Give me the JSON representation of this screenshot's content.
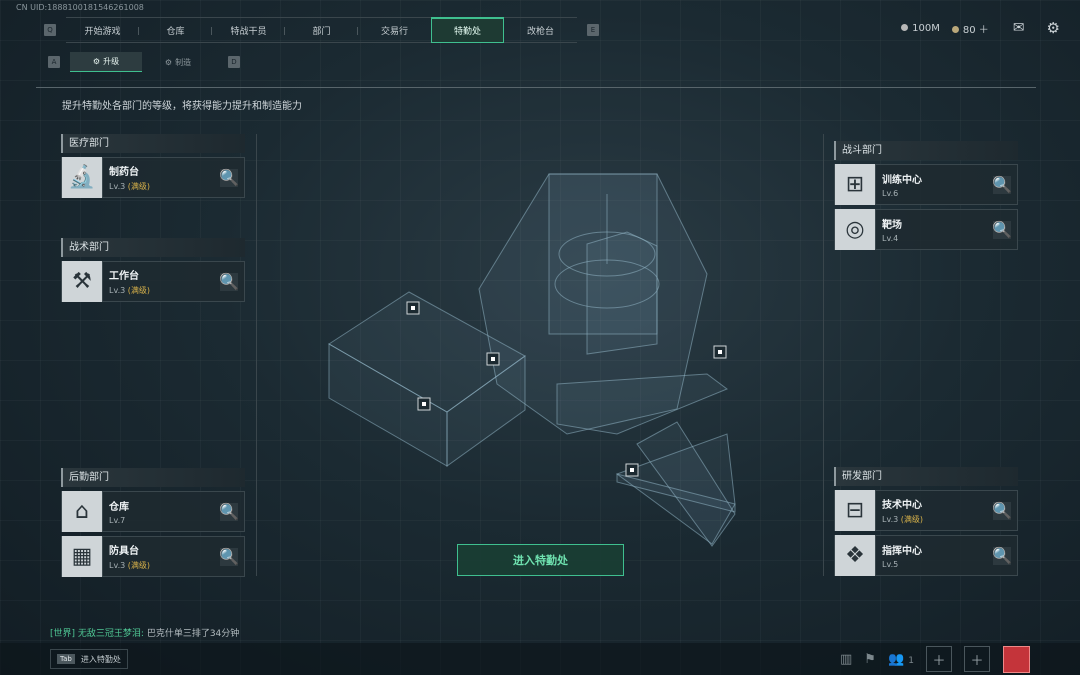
{
  "uid": "CN UID:1888100181546261008",
  "nav": {
    "left_key": "Q",
    "right_key": "E",
    "tabs": [
      {
        "label": "开始游戏"
      },
      {
        "label": "仓库"
      },
      {
        "label": "特战干员"
      },
      {
        "label": "部门"
      },
      {
        "label": "交易行"
      },
      {
        "label": "特勤处"
      },
      {
        "label": "改枪台"
      }
    ],
    "active_tab": "特勤处"
  },
  "resources": {
    "money": "100M",
    "coupons": "80"
  },
  "subnav": {
    "left_key": "A",
    "right_key": "D",
    "tabs": [
      "升级",
      "制造"
    ]
  },
  "intro": "提升特勤处各部门的等级，将获得能力提升和制造能力",
  "departments": {
    "medical": {
      "title": "医疗部门",
      "items": [
        {
          "name": "制药台",
          "level": "Lv.3",
          "tag": "(满级)"
        }
      ]
    },
    "tactical": {
      "title": "战术部门",
      "items": [
        {
          "name": "工作台",
          "level": "Lv.3",
          "tag": "(满级)"
        }
      ]
    },
    "logistics": {
      "title": "后勤部门",
      "items": [
        {
          "name": "仓库",
          "level": "Lv.7",
          "tag": ""
        },
        {
          "name": "防具台",
          "level": "Lv.3",
          "tag": "(满级)"
        }
      ]
    },
    "combat": {
      "title": "战斗部门",
      "items": [
        {
          "name": "训练中心",
          "level": "Lv.6",
          "tag": ""
        },
        {
          "name": "靶场",
          "level": "Lv.4",
          "tag": ""
        }
      ]
    },
    "research": {
      "title": "研发部门",
      "items": [
        {
          "name": "技术中心",
          "level": "Lv.3",
          "tag": "(满级)"
        },
        {
          "name": "指挥中心",
          "level": "Lv.5",
          "tag": ""
        }
      ]
    }
  },
  "enter_button": "进入特勤处",
  "chat": {
    "channel": "[世界]",
    "user": "无敌三冠王梦泪:",
    "message": "巴克什单三排了34分钟"
  },
  "tab_hint": {
    "key": "Tab",
    "label": "进入特勤处"
  },
  "squad_count": "1"
}
